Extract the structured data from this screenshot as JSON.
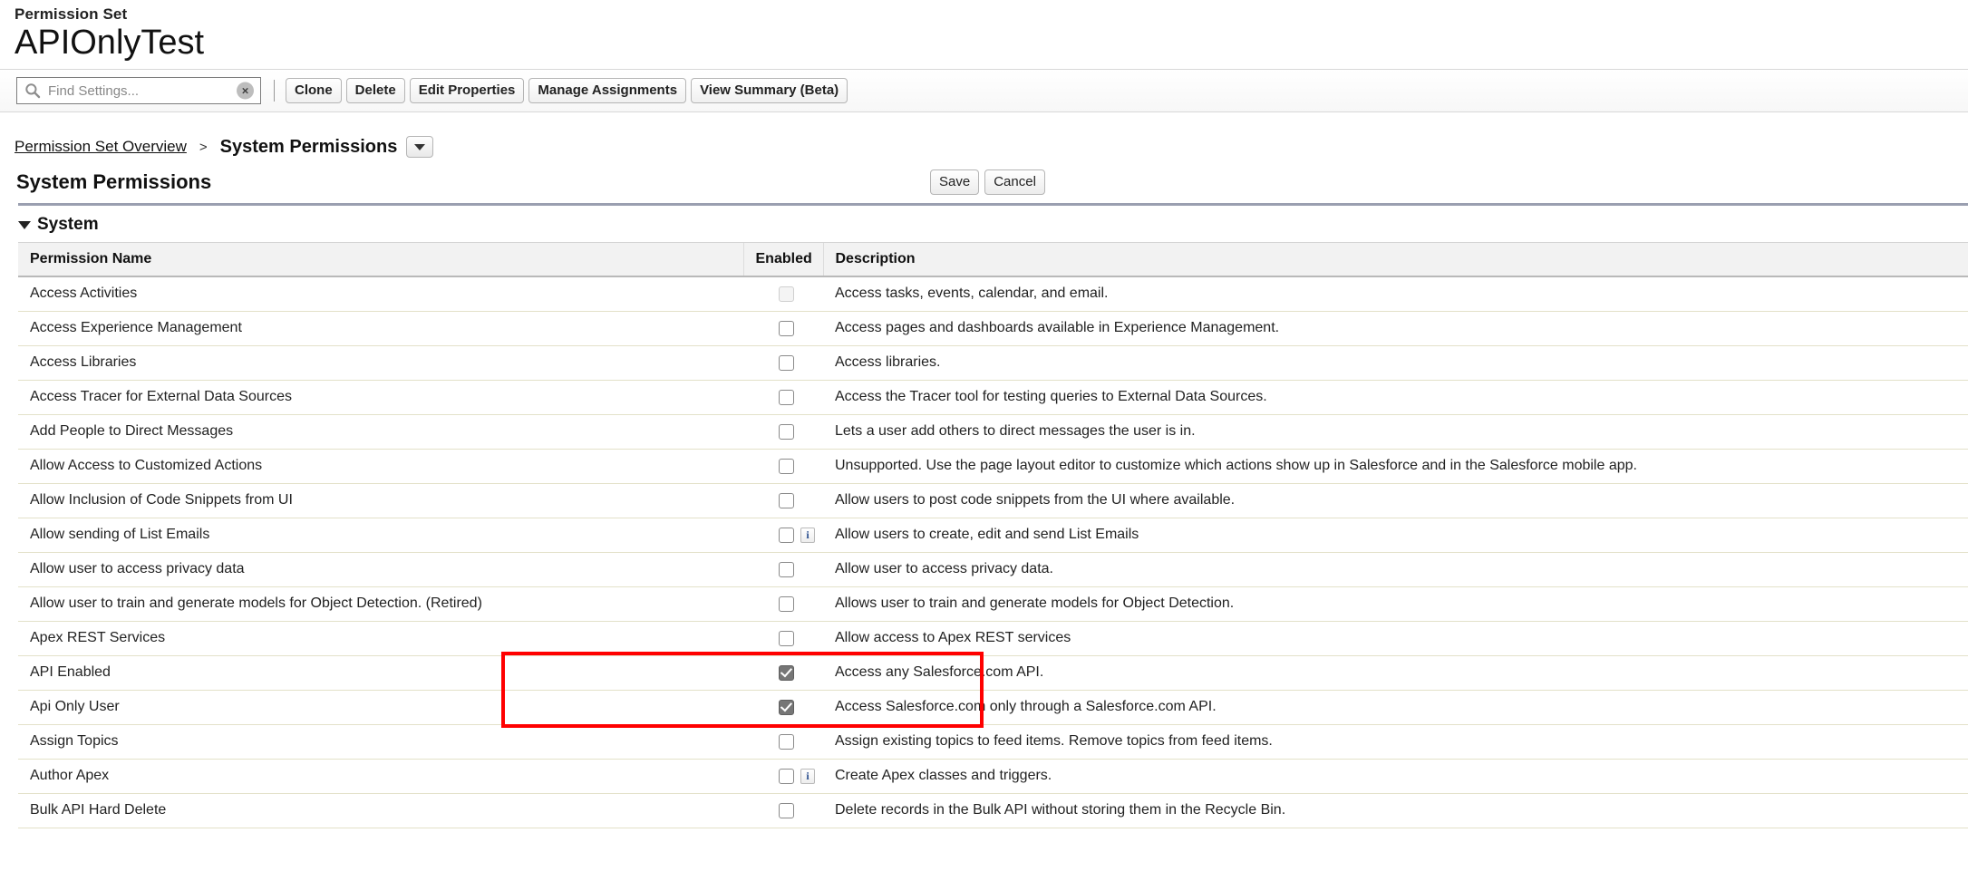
{
  "header": {
    "eyebrow": "Permission Set",
    "title": "APIOnlyTest"
  },
  "toolbar": {
    "search_placeholder": "Find Settings...",
    "search_value": "",
    "search_icon": "search-icon",
    "clear_icon": "×",
    "buttons": [
      {
        "label": "Clone"
      },
      {
        "label": "Delete"
      },
      {
        "label": "Edit Properties"
      },
      {
        "label": "Manage Assignments"
      },
      {
        "label": "View Summary (Beta)"
      }
    ]
  },
  "breadcrumb": {
    "parent": "Permission Set Overview",
    "separator": ">",
    "current": "System Permissions",
    "dropdown_icon": "chevron-down-icon"
  },
  "section": {
    "title": "System Permissions",
    "save_label": "Save",
    "cancel_label": "Cancel",
    "group_label": "System",
    "group_toggle_icon": "triangle-down-icon"
  },
  "table": {
    "columns": [
      "Permission Name",
      "Enabled",
      "Description"
    ],
    "rows": [
      {
        "name": "Access Activities",
        "enabled": false,
        "disabled": true,
        "info": false,
        "description": "Access tasks, events, calendar, and email."
      },
      {
        "name": "Access Experience Management",
        "enabled": false,
        "disabled": false,
        "info": false,
        "description": "Access pages and dashboards available in Experience Management."
      },
      {
        "name": "Access Libraries",
        "enabled": false,
        "disabled": false,
        "info": false,
        "description": "Access libraries."
      },
      {
        "name": "Access Tracer for External Data Sources",
        "enabled": false,
        "disabled": false,
        "info": false,
        "description": "Access the Tracer tool for testing queries to External Data Sources."
      },
      {
        "name": "Add People to Direct Messages",
        "enabled": false,
        "disabled": false,
        "info": false,
        "description": "Lets a user add others to direct messages the user is in."
      },
      {
        "name": "Allow Access to Customized Actions",
        "enabled": false,
        "disabled": false,
        "info": false,
        "description": "Unsupported. Use the page layout editor to customize which actions show up in Salesforce and in the Salesforce mobile app."
      },
      {
        "name": "Allow Inclusion of Code Snippets from UI",
        "enabled": false,
        "disabled": false,
        "info": false,
        "description": "Allow users to post code snippets from the UI where available."
      },
      {
        "name": "Allow sending of List Emails",
        "enabled": false,
        "disabled": false,
        "info": true,
        "description": "Allow users to create, edit and send List Emails"
      },
      {
        "name": "Allow user to access privacy data",
        "enabled": false,
        "disabled": false,
        "info": false,
        "description": "Allow user to access privacy data."
      },
      {
        "name": "Allow user to train and generate models for Object Detection. (Retired)",
        "enabled": false,
        "disabled": false,
        "info": false,
        "description": "Allows user to train and generate models for Object Detection."
      },
      {
        "name": "Apex REST Services",
        "enabled": false,
        "disabled": false,
        "info": false,
        "description": "Allow access to Apex REST services"
      },
      {
        "name": "API Enabled",
        "enabled": true,
        "disabled": false,
        "info": false,
        "description": "Access any Salesforce.com API."
      },
      {
        "name": "Api Only User",
        "enabled": true,
        "disabled": false,
        "info": false,
        "description": "Access Salesforce.com only through a Salesforce.com API."
      },
      {
        "name": "Assign Topics",
        "enabled": false,
        "disabled": false,
        "info": false,
        "description": "Assign existing topics to feed items. Remove topics from feed items."
      },
      {
        "name": "Author Apex",
        "enabled": false,
        "disabled": false,
        "info": true,
        "description": "Create Apex classes and triggers."
      },
      {
        "name": "Bulk API Hard Delete",
        "enabled": false,
        "disabled": false,
        "info": false,
        "description": "Delete records in the Bulk API without storing them in the Recycle Bin."
      }
    ]
  },
  "annotation": {
    "highlight_color": "#ff0000",
    "highlighted_rows": [
      "API Enabled",
      "Api Only User"
    ]
  }
}
